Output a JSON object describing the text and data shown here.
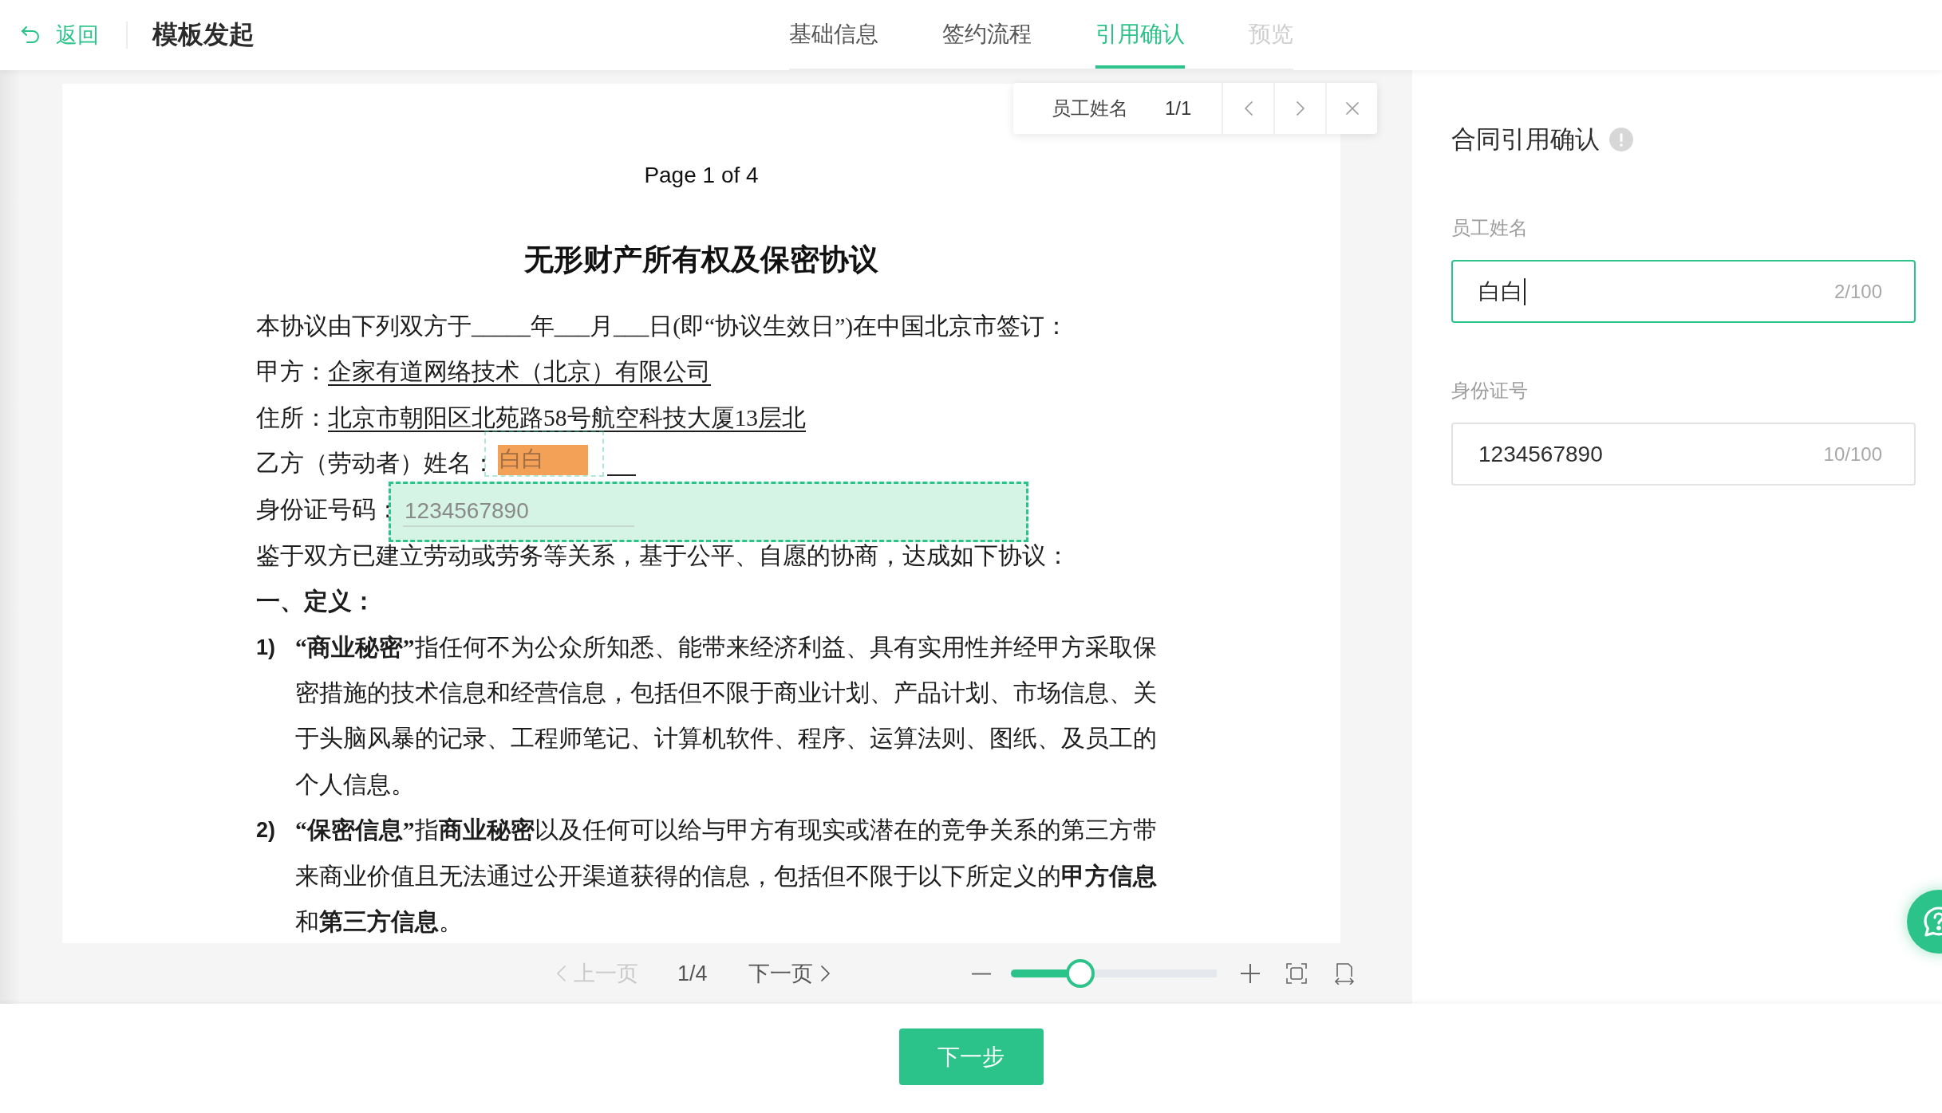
{
  "header": {
    "back_label": "返回",
    "title": "模板发起"
  },
  "tabs": [
    {
      "label": "基础信息",
      "selected": false,
      "disabled": false
    },
    {
      "label": "签约流程",
      "selected": false,
      "disabled": false
    },
    {
      "label": "引用确认",
      "selected": true,
      "disabled": false
    },
    {
      "label": "预览",
      "selected": false,
      "disabled": true
    }
  ],
  "find_bar": {
    "query": "员工姓名",
    "count": "1/1"
  },
  "document": {
    "page_label": "Page 1 of 4",
    "title": "无形财产所有权及保密协议",
    "blocks": [
      {
        "kind": "text",
        "text": "本协议由下列双方于_____年___月___日(即“协议生效日”)在中国北京市签订："
      },
      {
        "kind": "labeled",
        "label": "甲方：",
        "value": "企家有道网络技术（北京）有限公司"
      },
      {
        "kind": "labeled",
        "label": "住所：",
        "value": "北京市朝阳区北苑路58号航空科技大厦13层北"
      },
      {
        "kind": "field",
        "label": "乙方（劳动者）姓名：",
        "value": "白白",
        "selected": false,
        "search_match": true,
        "tail_blank": true
      },
      {
        "kind": "field",
        "label": "身份证号码：",
        "value": "1234567890",
        "selected": true,
        "search_match": false
      },
      {
        "kind": "text",
        "text": "鉴于双方已建立劳动或劳务等关系，基于公平、自愿的协商，达成如下协议："
      },
      {
        "kind": "heading",
        "text": "一、定义："
      },
      {
        "kind": "item",
        "number": "1)",
        "text": "**“商业秘密”**指任何不为公众所知悉、能带来经济利益、具有实用性并经甲方采取保密措施的技术信息和经营信息，包括但不限于商业计划、产品计划、市场信息、关于头脑风暴的记录、工程师笔记、计算机软件、程序、运算法则、图纸、及员工的个人信息。"
      },
      {
        "kind": "item",
        "number": "2)",
        "text": "**“保密信息”**指**商业秘密**以及任何可以给与甲方有现实或潜在的竞争关系的第三方带来商业价值且无法通过公开渠道获得的信息，包括但不限于以下所定义的**甲方信息**和**第三方信息**。"
      }
    ]
  },
  "pager": {
    "prev": {
      "label": "上一页",
      "disabled": true
    },
    "page": "1/4",
    "next": {
      "label": "下一页",
      "disabled": false
    }
  },
  "zoom": {
    "level": 0.34
  },
  "panel": {
    "title": "合同引用确认",
    "fields": [
      {
        "label": "员工姓名",
        "value": "白白",
        "counter": "2/100",
        "focused": true
      },
      {
        "label": "身份证号",
        "value": "1234567890",
        "counter": "10/100",
        "focused": false
      }
    ]
  },
  "footer": {
    "next_label": "下一步"
  }
}
